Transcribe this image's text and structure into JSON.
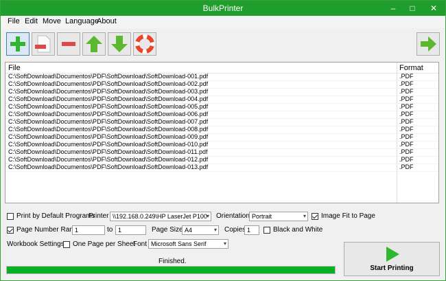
{
  "window": {
    "title": "BulkPrinter"
  },
  "menu": [
    "File",
    "Edit",
    "Move",
    "Language",
    "About"
  ],
  "toolbar": {
    "buttons": [
      "add-icon",
      "remove-sheet-icon",
      "remove-icon",
      "up-arrow-icon",
      "down-arrow-icon",
      "help-lifebuoy-icon"
    ],
    "next": "next-arrow-icon"
  },
  "filelist": {
    "headers": {
      "file": "File",
      "format": "Format"
    },
    "rows": [
      {
        "file": "C:\\SoftDownload\\Documentos\\PDF\\SoftDownload\\SoftDownload-001.pdf",
        "format": ".PDF"
      },
      {
        "file": "C:\\SoftDownload\\Documentos\\PDF\\SoftDownload\\SoftDownload-002.pdf",
        "format": ".PDF"
      },
      {
        "file": "C:\\SoftDownload\\Documentos\\PDF\\SoftDownload\\SoftDownload-003.pdf",
        "format": ".PDF"
      },
      {
        "file": "C:\\SoftDownload\\Documentos\\PDF\\SoftDownload\\SoftDownload-004.pdf",
        "format": ".PDF"
      },
      {
        "file": "C:\\SoftDownload\\Documentos\\PDF\\SoftDownload\\SoftDownload-005.pdf",
        "format": ".PDF"
      },
      {
        "file": "C:\\SoftDownload\\Documentos\\PDF\\SoftDownload\\SoftDownload-006.pdf",
        "format": ".PDF"
      },
      {
        "file": "C:\\SoftDownload\\Documentos\\PDF\\SoftDownload\\SoftDownload-007.pdf",
        "format": ".PDF"
      },
      {
        "file": "C:\\SoftDownload\\Documentos\\PDF\\SoftDownload\\SoftDownload-008.pdf",
        "format": ".PDF"
      },
      {
        "file": "C:\\SoftDownload\\Documentos\\PDF\\SoftDownload\\SoftDownload-009.pdf",
        "format": ".PDF"
      },
      {
        "file": "C:\\SoftDownload\\Documentos\\PDF\\SoftDownload\\SoftDownload-010.pdf",
        "format": ".PDF"
      },
      {
        "file": "C:\\SoftDownload\\Documentos\\PDF\\SoftDownload\\SoftDownload-011.pdf",
        "format": ".PDF"
      },
      {
        "file": "C:\\SoftDownload\\Documentos\\PDF\\SoftDownload\\SoftDownload-012.pdf",
        "format": ".PDF"
      },
      {
        "file": "C:\\SoftDownload\\Documentos\\PDF\\SoftDownload\\SoftDownload-013.pdf",
        "format": ".PDF"
      }
    ]
  },
  "options": {
    "print_default_label": "Print by Default Programs",
    "print_default_checked": false,
    "printer_label": "Printer",
    "printer_value": "\\\\192.168.0.249\\HP LaserJet P100",
    "orientation_label": "Orientation",
    "orientation_value": "Portrait",
    "image_fit_label": "Image Fit to Page",
    "image_fit_checked": true,
    "page_range_label": "Page Number Range",
    "page_range_checked": true,
    "range_from": "1",
    "range_to_label": "to",
    "range_to": "1",
    "page_size_label": "Page Size",
    "page_size_value": "A4",
    "copies_label": "Copies",
    "copies_value": "1",
    "bw_label": "Black and White",
    "bw_checked": false,
    "workbook_label": "Workbook Settings:",
    "one_page_label": "One Page per Sheet",
    "one_page_checked": false,
    "font_label": "Font",
    "font_value": "Microsoft Sans Serif"
  },
  "status": {
    "text": "Finished.",
    "progress": 1.0
  },
  "start_button": {
    "label": "Start Printing"
  },
  "colors": {
    "accent": "#1f9e2e",
    "progress": "#06b025"
  }
}
